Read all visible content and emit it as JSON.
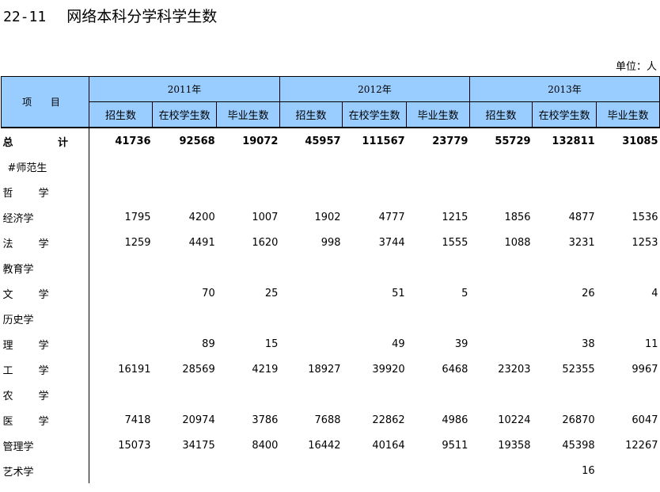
{
  "title": {
    "code": "22-11",
    "text": "网络本科分学科学生数"
  },
  "unit": "单位：人",
  "table": {
    "item_header": "项 目",
    "years": [
      "2011年",
      "2012年",
      "2013年"
    ],
    "sub_headers": [
      "招生数",
      "在校学生数",
      "毕业生数"
    ],
    "rows": [
      {
        "label": "总 计",
        "values": [
          "41736",
          "92568",
          "19072",
          "45957",
          "111567",
          "23779",
          "55729",
          "132811",
          "31085"
        ]
      },
      {
        "label": "#师范生",
        "values": [
          "",
          "",
          "",
          "",
          "",
          "",
          "",
          "",
          ""
        ]
      },
      {
        "label": "哲 学",
        "values": [
          "",
          "",
          "",
          "",
          "",
          "",
          "",
          "",
          ""
        ]
      },
      {
        "label": "经济学",
        "values": [
          "1795",
          "4200",
          "1007",
          "1902",
          "4777",
          "1215",
          "1856",
          "4877",
          "1536"
        ]
      },
      {
        "label": "法 学",
        "values": [
          "1259",
          "4491",
          "1620",
          "998",
          "3744",
          "1555",
          "1088",
          "3231",
          "1253"
        ]
      },
      {
        "label": "教育学",
        "values": [
          "",
          "",
          "",
          "",
          "",
          "",
          "",
          "",
          ""
        ]
      },
      {
        "label": "文 学",
        "values": [
          "",
          "70",
          "25",
          "",
          "51",
          "5",
          "",
          "26",
          "4"
        ]
      },
      {
        "label": "历史学",
        "values": [
          "",
          "",
          "",
          "",
          "",
          "",
          "",
          "",
          ""
        ]
      },
      {
        "label": "理 学",
        "values": [
          "",
          "89",
          "15",
          "",
          "49",
          "39",
          "",
          "38",
          "11"
        ]
      },
      {
        "label": "工 学",
        "values": [
          "16191",
          "28569",
          "4219",
          "18927",
          "39920",
          "6468",
          "23203",
          "52355",
          "9967"
        ]
      },
      {
        "label": "农 学",
        "values": [
          "",
          "",
          "",
          "",
          "",
          "",
          "",
          "",
          ""
        ]
      },
      {
        "label": "医 学",
        "values": [
          "7418",
          "20974",
          "3786",
          "7688",
          "22862",
          "4986",
          "10224",
          "26870",
          "6047"
        ]
      },
      {
        "label": "管理学",
        "values": [
          "15073",
          "34175",
          "8400",
          "16442",
          "40164",
          "9511",
          "19358",
          "45398",
          "12267"
        ]
      },
      {
        "label": "艺术学",
        "values": [
          "",
          "",
          "",
          "",
          "",
          "",
          "",
          "16",
          ""
        ]
      }
    ]
  },
  "colors": {
    "header_bg": "#99ccff",
    "border": "#000000"
  }
}
